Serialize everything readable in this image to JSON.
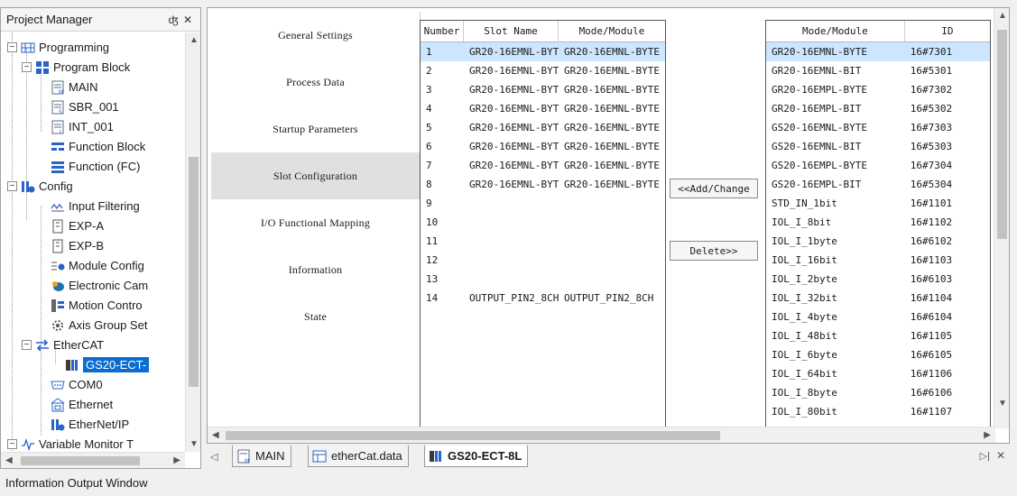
{
  "project_manager": {
    "title": "Project Manager",
    "pin_icon": "pin-icon",
    "close_icon": "close-icon",
    "tree": [
      {
        "label": "Programming",
        "icon": "ladder-icon"
      },
      {
        "label": "Program Block",
        "icon": "program-block-icon"
      },
      {
        "label": "MAIN",
        "icon": "main-file-icon"
      },
      {
        "label": "SBR_001",
        "icon": "subroutine-file-icon"
      },
      {
        "label": "INT_001",
        "icon": "interrupt-file-icon"
      },
      {
        "label": "Function Block",
        "icon": "function-block-icon"
      },
      {
        "label": "Function (FC)",
        "icon": "function-icon"
      },
      {
        "label": "Config",
        "icon": "config-icon"
      },
      {
        "label": "Input Filtering",
        "icon": "filter-icon"
      },
      {
        "label": "EXP-A",
        "icon": "expansion-icon"
      },
      {
        "label": "EXP-B",
        "icon": "expansion-icon"
      },
      {
        "label": "Module Config",
        "icon": "module-config-icon"
      },
      {
        "label": "Electronic Cam",
        "icon": "cam-icon"
      },
      {
        "label": "Motion Contro",
        "icon": "motion-icon"
      },
      {
        "label": "Axis Group Set",
        "icon": "axis-group-icon"
      },
      {
        "label": "EtherCAT",
        "icon": "ethercat-icon"
      },
      {
        "label": "GS20-ECT-",
        "icon": "device-icon"
      },
      {
        "label": "COM0",
        "icon": "com-port-icon"
      },
      {
        "label": "Ethernet",
        "icon": "ethernet-icon"
      },
      {
        "label": "EtherNet/IP",
        "icon": "ethernetip-icon"
      },
      {
        "label": "Variable Monitor T",
        "icon": "monitor-icon"
      }
    ]
  },
  "editor": {
    "nav": [
      {
        "label": "General Settings"
      },
      {
        "label": "Process Data"
      },
      {
        "label": "Startup Parameters"
      },
      {
        "label": "Slot Configuration",
        "active": true
      },
      {
        "label": "I/O Functional Mapping"
      },
      {
        "label": "Information"
      },
      {
        "label": "State"
      }
    ],
    "slot_table": {
      "headers": [
        "Number",
        "Slot Name",
        "Mode/Module"
      ],
      "rows": [
        [
          "1",
          "GR20-16EMNL-BYT",
          "GR20-16EMNL-BYTE"
        ],
        [
          "2",
          "GR20-16EMNL-BYT",
          "GR20-16EMNL-BYTE"
        ],
        [
          "3",
          "GR20-16EMNL-BYT",
          "GR20-16EMNL-BYTE"
        ],
        [
          "4",
          "GR20-16EMNL-BYT",
          "GR20-16EMNL-BYTE"
        ],
        [
          "5",
          "GR20-16EMNL-BYT",
          "GR20-16EMNL-BYTE"
        ],
        [
          "6",
          "GR20-16EMNL-BYT",
          "GR20-16EMNL-BYTE"
        ],
        [
          "7",
          "GR20-16EMNL-BYT",
          "GR20-16EMNL-BYTE"
        ],
        [
          "8",
          "GR20-16EMNL-BYT",
          "GR20-16EMNL-BYTE"
        ],
        [
          "9",
          "",
          ""
        ],
        [
          "10",
          "",
          ""
        ],
        [
          "11",
          "",
          ""
        ],
        [
          "12",
          "",
          ""
        ],
        [
          "13",
          "",
          ""
        ],
        [
          "14",
          "OUTPUT_PIN2_8CH",
          "OUTPUT_PIN2_8CH"
        ]
      ]
    },
    "add_change_label": "<<Add/Change",
    "delete_label": "Delete>>",
    "module_table": {
      "headers": [
        "Mode/Module",
        "ID"
      ],
      "rows": [
        [
          "GR20-16EMNL-BYTE",
          "16#7301"
        ],
        [
          "GR20-16EMNL-BIT",
          "16#5301"
        ],
        [
          "GR20-16EMPL-BYTE",
          "16#7302"
        ],
        [
          "GR20-16EMPL-BIT",
          "16#5302"
        ],
        [
          "GS20-16EMNL-BYTE",
          "16#7303"
        ],
        [
          "GS20-16EMNL-BIT",
          "16#5303"
        ],
        [
          "GS20-16EMPL-BYTE",
          "16#7304"
        ],
        [
          "GS20-16EMPL-BIT",
          "16#5304"
        ],
        [
          "STD_IN_1bit",
          "16#1101"
        ],
        [
          "IOL_I_8bit",
          "16#1102"
        ],
        [
          "IOL_I_1byte",
          "16#6102"
        ],
        [
          "IOL_I_16bit",
          "16#1103"
        ],
        [
          "IOL_I_2byte",
          "16#6103"
        ],
        [
          "IOL_I_32bit",
          "16#1104"
        ],
        [
          "IOL_I_4byte",
          "16#6104"
        ],
        [
          "IOL_I_48bit",
          "16#1105"
        ],
        [
          "IOL_I_6byte",
          "16#6105"
        ],
        [
          "IOL_I_64bit",
          "16#1106"
        ],
        [
          "IOL_I_8byte",
          "16#6106"
        ],
        [
          "IOL_I_80bit",
          "16#1107"
        ]
      ]
    }
  },
  "tabs": [
    {
      "label": "MAIN",
      "icon": "main-file-icon"
    },
    {
      "label": "etherCat.data",
      "icon": "data-file-icon"
    },
    {
      "label": "GS20-ECT-8L",
      "icon": "device-icon",
      "active": true
    }
  ],
  "status_bar": {
    "label": "Information Output Window"
  },
  "colors": {
    "selection": "#0a6ed0",
    "highlight_row": "#cce6ff",
    "nav_active": "#e0e0e0"
  }
}
